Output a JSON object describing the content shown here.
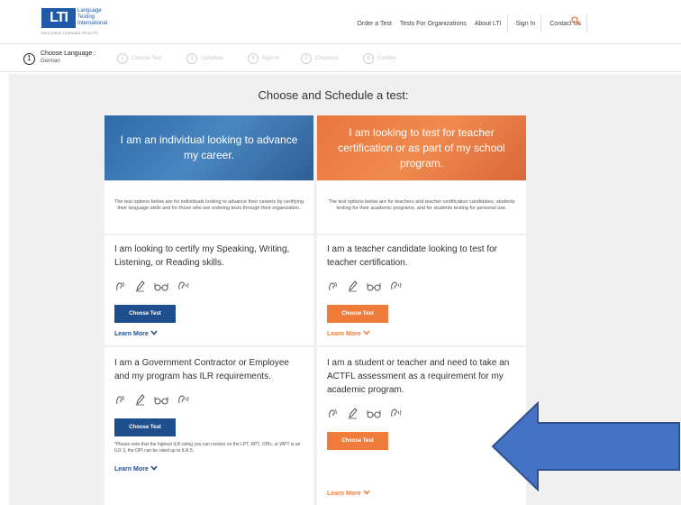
{
  "header": {
    "logo_mark": "LTI",
    "logo_sub": [
      "Language",
      "Testing",
      "International"
    ],
    "logo_tagline": "EXCLUSIVE LICENSEE OF ACTFL",
    "nav": [
      "Order a Test",
      "Tests For Organizations",
      "About LTI",
      "Sign In",
      "Contact Us"
    ]
  },
  "steps": {
    "current_num": "1",
    "current_label": "Choose Language :",
    "current_value": "German",
    "others": [
      {
        "num": "2",
        "label": "Choose Test"
      },
      {
        "num": "3",
        "label": "Schedule"
      },
      {
        "num": "4",
        "label": "Sign In"
      },
      {
        "num": "5",
        "label": "Checkout"
      },
      {
        "num": "6",
        "label": "Confirm"
      }
    ]
  },
  "main": {
    "title": "Choose and Schedule a test:",
    "left": {
      "banner": "I am an individual looking to advance my career.",
      "intro": "The test options below are for individuals looking to advance their careers by certifying their language skills and for those who are ordering tests through their organization.",
      "card1_title": "I am looking to certify my Speaking, Writing, Listening, or Reading skills.",
      "card1_button": "Choose Test",
      "card1_learn": "Learn More",
      "card2_title": "I am a Government Contractor or Employee and my program has ILR requirements.",
      "card2_button": "Choose Test",
      "card2_note": "*Please note that the highest ILR rating you can receive on the LPT, RPT, OPIc, or WPT is an ILR 3, the OPI can be rated up to ILR 5.",
      "card2_learn": "Learn More"
    },
    "right": {
      "banner": "I am looking to test for teacher certification or as part of my school program.",
      "intro": "The test options below are for teachers and teacher certification candidates, students testing for their academic programs, and for students testing for personal use.",
      "card1_title": "I am a teacher candidate looking to test for teacher certification.",
      "card1_button": "Choose Test",
      "card1_learn": "Learn More",
      "card2_title": "I am a student or teacher and need to take an ACTFL assessment as a requirement for my academic program.",
      "card2_button": "Choose Test",
      "card2_learn": "Learn More"
    }
  },
  "colors": {
    "brand_blue": "#1e4f8c",
    "brand_orange": "#f07c3b",
    "arrow_blue": "#4472c4"
  },
  "icons": [
    "speaking-icon",
    "writing-icon",
    "reading-icon",
    "listening-icon"
  ]
}
